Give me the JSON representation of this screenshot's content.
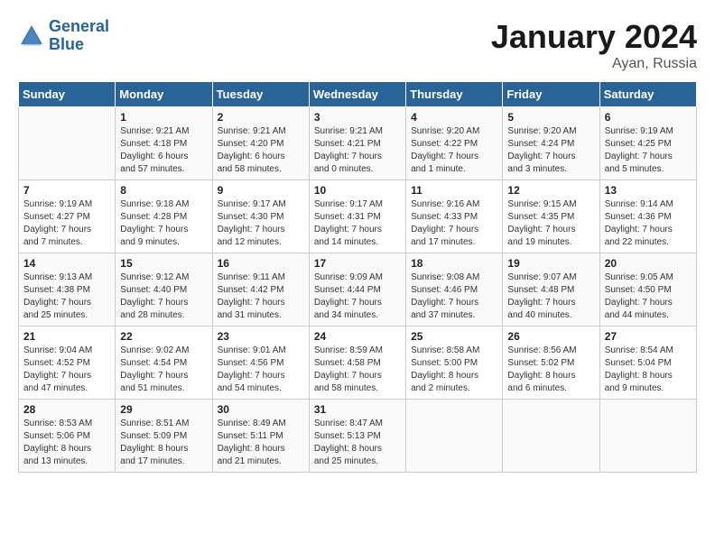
{
  "header": {
    "logo_line1": "General",
    "logo_line2": "Blue",
    "title": "January 2024",
    "subtitle": "Ayan, Russia"
  },
  "columns": [
    "Sunday",
    "Monday",
    "Tuesday",
    "Wednesday",
    "Thursday",
    "Friday",
    "Saturday"
  ],
  "rows": [
    [
      {
        "day": "",
        "info": ""
      },
      {
        "day": "1",
        "info": "Sunrise: 9:21 AM\nSunset: 4:18 PM\nDaylight: 6 hours\nand 57 minutes."
      },
      {
        "day": "2",
        "info": "Sunrise: 9:21 AM\nSunset: 4:20 PM\nDaylight: 6 hours\nand 58 minutes."
      },
      {
        "day": "3",
        "info": "Sunrise: 9:21 AM\nSunset: 4:21 PM\nDaylight: 7 hours\nand 0 minutes."
      },
      {
        "day": "4",
        "info": "Sunrise: 9:20 AM\nSunset: 4:22 PM\nDaylight: 7 hours\nand 1 minute."
      },
      {
        "day": "5",
        "info": "Sunrise: 9:20 AM\nSunset: 4:24 PM\nDaylight: 7 hours\nand 3 minutes."
      },
      {
        "day": "6",
        "info": "Sunrise: 9:19 AM\nSunset: 4:25 PM\nDaylight: 7 hours\nand 5 minutes."
      }
    ],
    [
      {
        "day": "7",
        "info": "Sunrise: 9:19 AM\nSunset: 4:27 PM\nDaylight: 7 hours\nand 7 minutes."
      },
      {
        "day": "8",
        "info": "Sunrise: 9:18 AM\nSunset: 4:28 PM\nDaylight: 7 hours\nand 9 minutes."
      },
      {
        "day": "9",
        "info": "Sunrise: 9:17 AM\nSunset: 4:30 PM\nDaylight: 7 hours\nand 12 minutes."
      },
      {
        "day": "10",
        "info": "Sunrise: 9:17 AM\nSunset: 4:31 PM\nDaylight: 7 hours\nand 14 minutes."
      },
      {
        "day": "11",
        "info": "Sunrise: 9:16 AM\nSunset: 4:33 PM\nDaylight: 7 hours\nand 17 minutes."
      },
      {
        "day": "12",
        "info": "Sunrise: 9:15 AM\nSunset: 4:35 PM\nDaylight: 7 hours\nand 19 minutes."
      },
      {
        "day": "13",
        "info": "Sunrise: 9:14 AM\nSunset: 4:36 PM\nDaylight: 7 hours\nand 22 minutes."
      }
    ],
    [
      {
        "day": "14",
        "info": "Sunrise: 9:13 AM\nSunset: 4:38 PM\nDaylight: 7 hours\nand 25 minutes."
      },
      {
        "day": "15",
        "info": "Sunrise: 9:12 AM\nSunset: 4:40 PM\nDaylight: 7 hours\nand 28 minutes."
      },
      {
        "day": "16",
        "info": "Sunrise: 9:11 AM\nSunset: 4:42 PM\nDaylight: 7 hours\nand 31 minutes."
      },
      {
        "day": "17",
        "info": "Sunrise: 9:09 AM\nSunset: 4:44 PM\nDaylight: 7 hours\nand 34 minutes."
      },
      {
        "day": "18",
        "info": "Sunrise: 9:08 AM\nSunset: 4:46 PM\nDaylight: 7 hours\nand 37 minutes."
      },
      {
        "day": "19",
        "info": "Sunrise: 9:07 AM\nSunset: 4:48 PM\nDaylight: 7 hours\nand 40 minutes."
      },
      {
        "day": "20",
        "info": "Sunrise: 9:05 AM\nSunset: 4:50 PM\nDaylight: 7 hours\nand 44 minutes."
      }
    ],
    [
      {
        "day": "21",
        "info": "Sunrise: 9:04 AM\nSunset: 4:52 PM\nDaylight: 7 hours\nand 47 minutes."
      },
      {
        "day": "22",
        "info": "Sunrise: 9:02 AM\nSunset: 4:54 PM\nDaylight: 7 hours\nand 51 minutes."
      },
      {
        "day": "23",
        "info": "Sunrise: 9:01 AM\nSunset: 4:56 PM\nDaylight: 7 hours\nand 54 minutes."
      },
      {
        "day": "24",
        "info": "Sunrise: 8:59 AM\nSunset: 4:58 PM\nDaylight: 7 hours\nand 58 minutes."
      },
      {
        "day": "25",
        "info": "Sunrise: 8:58 AM\nSunset: 5:00 PM\nDaylight: 8 hours\nand 2 minutes."
      },
      {
        "day": "26",
        "info": "Sunrise: 8:56 AM\nSunset: 5:02 PM\nDaylight: 8 hours\nand 6 minutes."
      },
      {
        "day": "27",
        "info": "Sunrise: 8:54 AM\nSunset: 5:04 PM\nDaylight: 8 hours\nand 9 minutes."
      }
    ],
    [
      {
        "day": "28",
        "info": "Sunrise: 8:53 AM\nSunset: 5:06 PM\nDaylight: 8 hours\nand 13 minutes."
      },
      {
        "day": "29",
        "info": "Sunrise: 8:51 AM\nSunset: 5:09 PM\nDaylight: 8 hours\nand 17 minutes."
      },
      {
        "day": "30",
        "info": "Sunrise: 8:49 AM\nSunset: 5:11 PM\nDaylight: 8 hours\nand 21 minutes."
      },
      {
        "day": "31",
        "info": "Sunrise: 8:47 AM\nSunset: 5:13 PM\nDaylight: 8 hours\nand 25 minutes."
      },
      {
        "day": "",
        "info": ""
      },
      {
        "day": "",
        "info": ""
      },
      {
        "day": "",
        "info": ""
      }
    ]
  ]
}
